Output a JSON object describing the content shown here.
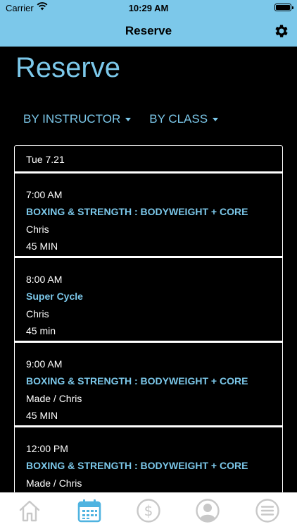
{
  "status_bar": {
    "carrier": "Carrier",
    "time": "10:29 AM"
  },
  "nav": {
    "title": "Reserve",
    "settings_icon": "gear-icon"
  },
  "page": {
    "heading": "Reserve"
  },
  "filters": [
    {
      "label": "BY INSTRUCTOR"
    },
    {
      "label": "BY CLASS"
    }
  ],
  "schedule": {
    "day": "Tue 7.21",
    "classes": [
      {
        "time": "7:00 AM",
        "name": "BOXING & STRENGTH : BODYWEIGHT + CORE",
        "instructor": "Chris",
        "duration": "45 MIN"
      },
      {
        "time": "8:00 AM",
        "name": "Super Cycle",
        "instructor": "Chris",
        "duration": "45 min"
      },
      {
        "time": "9:00 AM",
        "name": "BOXING & STRENGTH : BODYWEIGHT + CORE",
        "instructor": "Made / Chris",
        "duration": "45 MIN"
      },
      {
        "time": "12:00 PM",
        "name": "BOXING & STRENGTH : BODYWEIGHT + CORE",
        "instructor": "Made / Chris",
        "duration": ""
      }
    ]
  },
  "tab_bar": {
    "items": [
      {
        "icon": "home-icon",
        "active": false
      },
      {
        "icon": "calendar-icon",
        "active": true
      },
      {
        "icon": "dollar-icon",
        "active": false
      },
      {
        "icon": "profile-icon",
        "active": false
      },
      {
        "icon": "menu-icon",
        "active": false
      }
    ],
    "active_color": "#4fb3e0",
    "inactive_color": "#c8c8c8"
  },
  "colors": {
    "accent": "#7cc8ea",
    "background": "#000000"
  }
}
